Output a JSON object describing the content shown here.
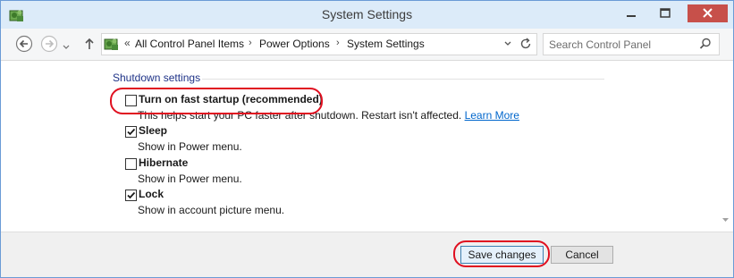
{
  "window": {
    "title": "System Settings"
  },
  "navbar": {
    "address_chevron": "«",
    "breadcrumbs": [
      "All Control Panel Items",
      "Power Options",
      "System Settings"
    ],
    "separator": "›",
    "search_placeholder": "Search Control Panel"
  },
  "content": {
    "section_heading": "Shutdown settings",
    "options": [
      {
        "label": "Turn on fast startup (recommended)",
        "description": "This helps start your PC faster after shutdown. Restart isn't affected.",
        "link": "Learn More",
        "checked": false
      },
      {
        "label": "Sleep",
        "description": "Show in Power menu.",
        "checked": true
      },
      {
        "label": "Hibernate",
        "description": "Show in Power menu.",
        "checked": false
      },
      {
        "label": "Lock",
        "description": "Show in account picture menu.",
        "checked": true
      }
    ]
  },
  "footer": {
    "save_label": "Save changes",
    "cancel_label": "Cancel"
  },
  "colors": {
    "highlight_ring": "#e01020",
    "link": "#0066cc",
    "close_button": "#c7504a",
    "title_bar": "#dcebf9"
  },
  "icons": {
    "app": "control-panel-icon",
    "back": "back-arrow-icon",
    "forward": "forward-arrow-icon",
    "up": "up-arrow-icon",
    "refresh": "refresh-icon",
    "search": "search-icon"
  }
}
